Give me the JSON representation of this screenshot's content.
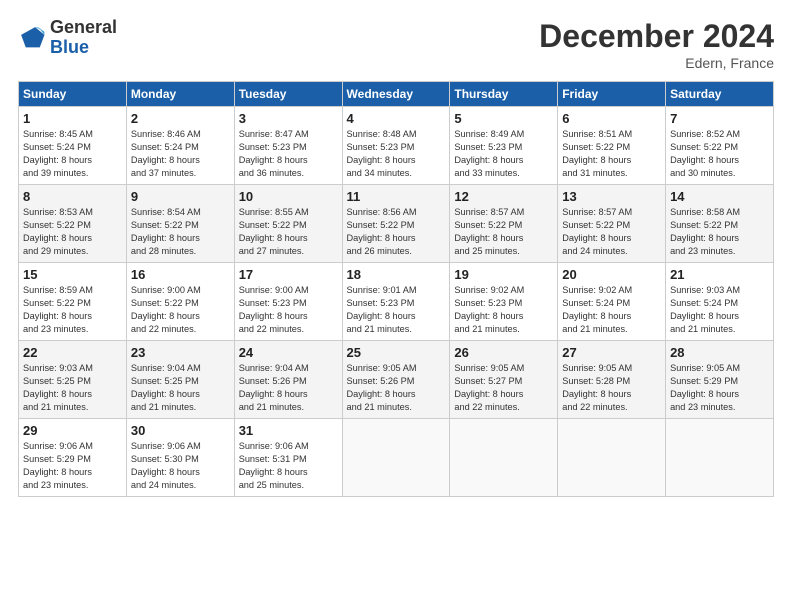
{
  "logo": {
    "general": "General",
    "blue": "Blue"
  },
  "header": {
    "month": "December 2024",
    "location": "Edern, France"
  },
  "days_of_week": [
    "Sunday",
    "Monday",
    "Tuesday",
    "Wednesday",
    "Thursday",
    "Friday",
    "Saturday"
  ],
  "weeks": [
    [
      {
        "day": "1",
        "info": "Sunrise: 8:45 AM\nSunset: 5:24 PM\nDaylight: 8 hours\nand 39 minutes."
      },
      {
        "day": "2",
        "info": "Sunrise: 8:46 AM\nSunset: 5:24 PM\nDaylight: 8 hours\nand 37 minutes."
      },
      {
        "day": "3",
        "info": "Sunrise: 8:47 AM\nSunset: 5:23 PM\nDaylight: 8 hours\nand 36 minutes."
      },
      {
        "day": "4",
        "info": "Sunrise: 8:48 AM\nSunset: 5:23 PM\nDaylight: 8 hours\nand 34 minutes."
      },
      {
        "day": "5",
        "info": "Sunrise: 8:49 AM\nSunset: 5:23 PM\nDaylight: 8 hours\nand 33 minutes."
      },
      {
        "day": "6",
        "info": "Sunrise: 8:51 AM\nSunset: 5:22 PM\nDaylight: 8 hours\nand 31 minutes."
      },
      {
        "day": "7",
        "info": "Sunrise: 8:52 AM\nSunset: 5:22 PM\nDaylight: 8 hours\nand 30 minutes."
      }
    ],
    [
      {
        "day": "8",
        "info": "Sunrise: 8:53 AM\nSunset: 5:22 PM\nDaylight: 8 hours\nand 29 minutes."
      },
      {
        "day": "9",
        "info": "Sunrise: 8:54 AM\nSunset: 5:22 PM\nDaylight: 8 hours\nand 28 minutes."
      },
      {
        "day": "10",
        "info": "Sunrise: 8:55 AM\nSunset: 5:22 PM\nDaylight: 8 hours\nand 27 minutes."
      },
      {
        "day": "11",
        "info": "Sunrise: 8:56 AM\nSunset: 5:22 PM\nDaylight: 8 hours\nand 26 minutes."
      },
      {
        "day": "12",
        "info": "Sunrise: 8:57 AM\nSunset: 5:22 PM\nDaylight: 8 hours\nand 25 minutes."
      },
      {
        "day": "13",
        "info": "Sunrise: 8:57 AM\nSunset: 5:22 PM\nDaylight: 8 hours\nand 24 minutes."
      },
      {
        "day": "14",
        "info": "Sunrise: 8:58 AM\nSunset: 5:22 PM\nDaylight: 8 hours\nand 23 minutes."
      }
    ],
    [
      {
        "day": "15",
        "info": "Sunrise: 8:59 AM\nSunset: 5:22 PM\nDaylight: 8 hours\nand 23 minutes."
      },
      {
        "day": "16",
        "info": "Sunrise: 9:00 AM\nSunset: 5:22 PM\nDaylight: 8 hours\nand 22 minutes."
      },
      {
        "day": "17",
        "info": "Sunrise: 9:00 AM\nSunset: 5:23 PM\nDaylight: 8 hours\nand 22 minutes."
      },
      {
        "day": "18",
        "info": "Sunrise: 9:01 AM\nSunset: 5:23 PM\nDaylight: 8 hours\nand 21 minutes."
      },
      {
        "day": "19",
        "info": "Sunrise: 9:02 AM\nSunset: 5:23 PM\nDaylight: 8 hours\nand 21 minutes."
      },
      {
        "day": "20",
        "info": "Sunrise: 9:02 AM\nSunset: 5:24 PM\nDaylight: 8 hours\nand 21 minutes."
      },
      {
        "day": "21",
        "info": "Sunrise: 9:03 AM\nSunset: 5:24 PM\nDaylight: 8 hours\nand 21 minutes."
      }
    ],
    [
      {
        "day": "22",
        "info": "Sunrise: 9:03 AM\nSunset: 5:25 PM\nDaylight: 8 hours\nand 21 minutes."
      },
      {
        "day": "23",
        "info": "Sunrise: 9:04 AM\nSunset: 5:25 PM\nDaylight: 8 hours\nand 21 minutes."
      },
      {
        "day": "24",
        "info": "Sunrise: 9:04 AM\nSunset: 5:26 PM\nDaylight: 8 hours\nand 21 minutes."
      },
      {
        "day": "25",
        "info": "Sunrise: 9:05 AM\nSunset: 5:26 PM\nDaylight: 8 hours\nand 21 minutes."
      },
      {
        "day": "26",
        "info": "Sunrise: 9:05 AM\nSunset: 5:27 PM\nDaylight: 8 hours\nand 22 minutes."
      },
      {
        "day": "27",
        "info": "Sunrise: 9:05 AM\nSunset: 5:28 PM\nDaylight: 8 hours\nand 22 minutes."
      },
      {
        "day": "28",
        "info": "Sunrise: 9:05 AM\nSunset: 5:29 PM\nDaylight: 8 hours\nand 23 minutes."
      }
    ],
    [
      {
        "day": "29",
        "info": "Sunrise: 9:06 AM\nSunset: 5:29 PM\nDaylight: 8 hours\nand 23 minutes."
      },
      {
        "day": "30",
        "info": "Sunrise: 9:06 AM\nSunset: 5:30 PM\nDaylight: 8 hours\nand 24 minutes."
      },
      {
        "day": "31",
        "info": "Sunrise: 9:06 AM\nSunset: 5:31 PM\nDaylight: 8 hours\nand 25 minutes."
      },
      {
        "day": "",
        "info": ""
      },
      {
        "day": "",
        "info": ""
      },
      {
        "day": "",
        "info": ""
      },
      {
        "day": "",
        "info": ""
      }
    ]
  ]
}
